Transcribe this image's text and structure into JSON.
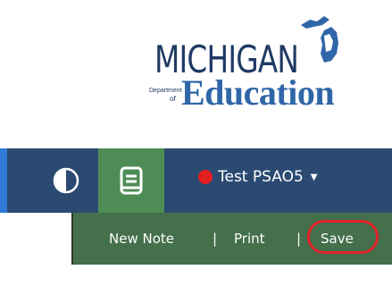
{
  "logo": {
    "title": "MICHIGAN",
    "department": "Department",
    "of": "of",
    "education": "Education"
  },
  "toolbar": {
    "contrast_icon": "contrast-icon",
    "book_icon": "notebook-icon",
    "test_name": "Test PSAO5",
    "status_color": "#e41e1e"
  },
  "subtoolbar": {
    "new_note": "New Note",
    "separator": "|",
    "print": "Print",
    "save": "Save"
  },
  "colors": {
    "topbar": "#2b4a72",
    "accent": "#2f7bd6",
    "book_button": "#4e8c56",
    "subtoolbar": "#44704b",
    "highlight": "#e2222a"
  }
}
